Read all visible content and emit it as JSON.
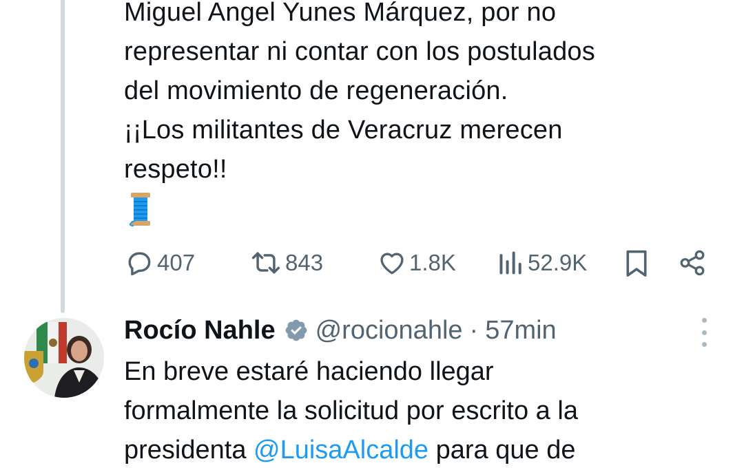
{
  "tweet": {
    "text_lines": [
      "Miguel Angel Yunes Márquez, por no",
      "representar ni contar con los postulados",
      "del movimiento de regeneración.",
      "¡¡Los militantes de Veracruz merecen",
      "respeto!!"
    ],
    "emoji_icon": "thread-spool-icon",
    "actions": {
      "replies": "407",
      "retweets": "843",
      "likes": "1.8K",
      "views": "52.9K"
    }
  },
  "reply": {
    "name": "Rocío Nahle",
    "handle": "@rocionahle",
    "separator": "·",
    "time": "57min",
    "text_lines": [
      "En breve estaré haciendo llegar",
      "formalmente la solicitud por escrito a la",
      "presidenta ",
      "@LuisaAlcalde",
      " para que de"
    ]
  },
  "colors": {
    "text": "#0f1419",
    "secondary": "#536471",
    "verified": "#829aab",
    "thread_line": "#cfd9de",
    "link": "#1d9bf0"
  }
}
